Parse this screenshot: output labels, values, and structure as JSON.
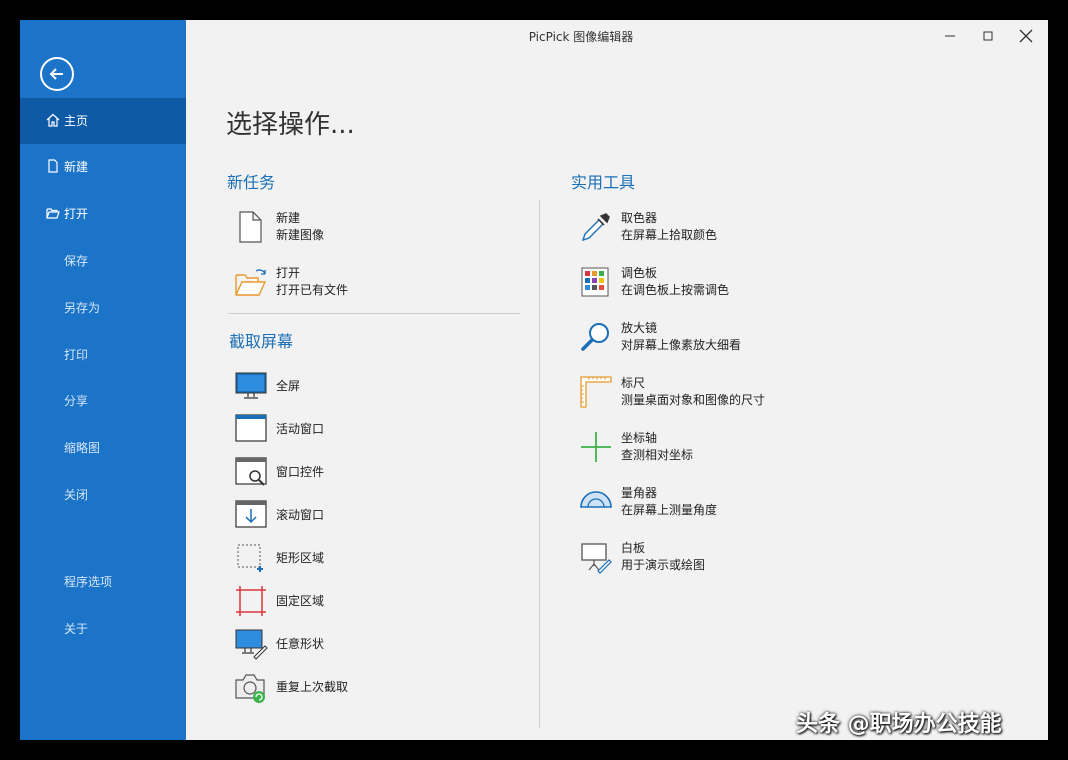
{
  "window": {
    "title": "PicPick 图像编辑器"
  },
  "sidebar": {
    "items": [
      {
        "label": "主页"
      },
      {
        "label": "新建"
      },
      {
        "label": "打开"
      },
      {
        "label": "保存"
      },
      {
        "label": "另存为"
      },
      {
        "label": "打印"
      },
      {
        "label": "分享"
      },
      {
        "label": "缩略图"
      },
      {
        "label": "关闭"
      },
      {
        "label": "程序选项"
      },
      {
        "label": "关于"
      }
    ]
  },
  "main": {
    "heading": "选择操作...",
    "new_task": {
      "title": "新任务",
      "items": [
        {
          "name": "新建",
          "desc": "新建图像"
        },
        {
          "name": "打开",
          "desc": "打开已有文件"
        }
      ]
    },
    "capture": {
      "title": "截取屏幕",
      "items": [
        {
          "name": "全屏"
        },
        {
          "name": "活动窗口"
        },
        {
          "name": "窗口控件"
        },
        {
          "name": "滚动窗口"
        },
        {
          "name": "矩形区域"
        },
        {
          "name": "固定区域"
        },
        {
          "name": "任意形状"
        },
        {
          "name": "重复上次截取"
        }
      ]
    },
    "tools": {
      "title": "实用工具",
      "items": [
        {
          "name": "取色器",
          "desc": "在屏幕上拾取颜色"
        },
        {
          "name": "调色板",
          "desc": "在调色板上按需调色"
        },
        {
          "name": "放大镜",
          "desc": "对屏幕上像素放大细看"
        },
        {
          "name": "标尺",
          "desc": "测量桌面对象和图像的尺寸"
        },
        {
          "name": "坐标轴",
          "desc": "查测相对坐标"
        },
        {
          "name": "量角器",
          "desc": "在屏幕上测量角度"
        },
        {
          "name": "白板",
          "desc": "用于演示或绘图"
        }
      ]
    }
  },
  "watermark": "头条 @职场办公技能",
  "colors": {
    "sidebar": "#1b74c8",
    "sidebar_active": "#0e5aa7",
    "accent": "#1a6fb7",
    "background": "#f2f2f2"
  }
}
